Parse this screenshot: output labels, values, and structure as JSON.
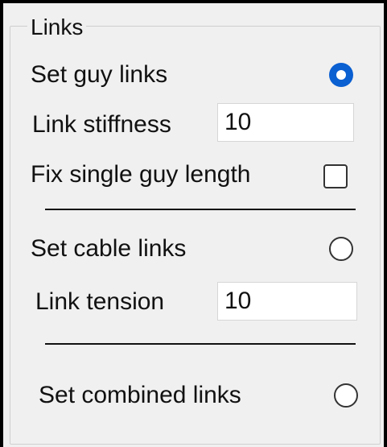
{
  "group": {
    "title": "Links"
  },
  "guy": {
    "label": "Set guy links",
    "selected": true,
    "stiffness_label": "Link stiffness",
    "stiffness_value": "10",
    "fix_single_label": "Fix single guy length",
    "fix_single_checked": false
  },
  "cable": {
    "label": "Set cable links",
    "selected": false,
    "tension_label": "Link tension",
    "tension_value": "10"
  },
  "combined": {
    "label": "Set combined links",
    "selected": false
  },
  "colors": {
    "accent": "#0a5fd1",
    "background": "#f0f0f0"
  }
}
